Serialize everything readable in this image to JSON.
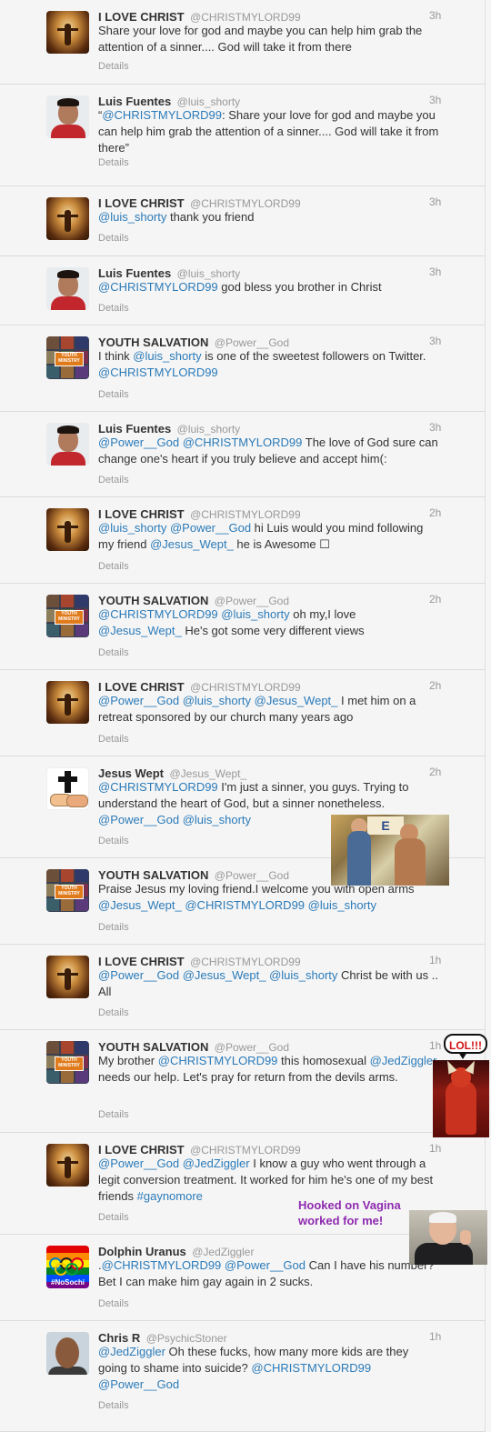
{
  "tweets": [
    {
      "avatar": "christ",
      "name": "I LOVE CHRIST",
      "handle": "@CHRISTMYLORD99",
      "time": "3h",
      "text": [
        {
          "t": "Share your love for god and maybe you can help him grab the attention of a sinner.... God will take it from there"
        }
      ],
      "details": "Details"
    },
    {
      "avatar": "luis",
      "name": "Luis Fuentes",
      "handle": "@luis_shorty",
      "time": "3h",
      "text": [
        {
          "t": "“"
        },
        {
          "m": "@CHRISTMYLORD99"
        },
        {
          "t": ": Share your love for god and maybe you can help him grab the attention of a sinner.... God will take it from there”"
        }
      ],
      "details": "Details"
    },
    {
      "avatar": "christ",
      "name": "I LOVE CHRIST",
      "handle": "@CHRISTMYLORD99",
      "time": "3h",
      "text": [
        {
          "m": "@luis_shorty"
        },
        {
          "t": " thank you friend"
        }
      ],
      "details": "Details"
    },
    {
      "avatar": "luis",
      "name": "Luis Fuentes",
      "handle": "@luis_shorty",
      "time": "3h",
      "text": [
        {
          "m": "@CHRISTMYLORD99"
        },
        {
          "t": " god bless you brother in Christ"
        }
      ],
      "details": "Details"
    },
    {
      "avatar": "youth",
      "name": "YOUTH SALVATION",
      "handle": "@Power__God",
      "time": "3h",
      "text": [
        {
          "t": "I think "
        },
        {
          "m": "@luis_shorty"
        },
        {
          "t": " is one of the sweetest followers on Twitter. "
        },
        {
          "m": "@CHRISTMYLORD99"
        }
      ],
      "details": "Details"
    },
    {
      "avatar": "luis",
      "name": "Luis Fuentes",
      "handle": "@luis_shorty",
      "time": "3h",
      "text": [
        {
          "m": "@Power__God"
        },
        {
          "t": " "
        },
        {
          "m": "@CHRISTMYLORD99"
        },
        {
          "t": " The love of God sure can change one's heart if you truly believe and accept him(:"
        }
      ],
      "details": "Details"
    },
    {
      "avatar": "christ",
      "name": "I LOVE CHRIST",
      "handle": "@CHRISTMYLORD99",
      "time": "2h",
      "text": [
        {
          "m": "@luis_shorty"
        },
        {
          "t": " "
        },
        {
          "m": "@Power__God"
        },
        {
          "t": "  hi Luis would you mind following my friend "
        },
        {
          "m": "@Jesus_Wept_"
        },
        {
          "t": "  he is Awesome ☐"
        }
      ],
      "details": "Details"
    },
    {
      "avatar": "youth",
      "name": "YOUTH SALVATION",
      "handle": "@Power__God",
      "time": "2h",
      "text": [
        {
          "m": "@CHRISTMYLORD99"
        },
        {
          "t": " "
        },
        {
          "m": "@luis_shorty"
        },
        {
          "t": " oh my,I love "
        },
        {
          "m": "@Jesus_Wept_"
        },
        {
          "t": " He's got some very different views"
        }
      ],
      "details": "Details"
    },
    {
      "avatar": "christ",
      "name": "I LOVE CHRIST",
      "handle": "@CHRISTMYLORD99",
      "time": "2h",
      "text": [
        {
          "m": "@Power__God"
        },
        {
          "t": " "
        },
        {
          "m": "@luis_shorty"
        },
        {
          "t": " "
        },
        {
          "m": "@Jesus_Wept_"
        },
        {
          "t": "  I met him on a retreat sponsored by our church many years ago"
        }
      ],
      "details": "Details"
    },
    {
      "avatar": "wept",
      "name": "Jesus Wept",
      "handle": "@Jesus_Wept_",
      "time": "2h",
      "text": [
        {
          "m": "@CHRISTMYLORD99"
        },
        {
          "t": " I'm just a sinner, you guys. Trying to understand the heart of God, but a sinner nonetheless. "
        },
        {
          "m": "@Power__God"
        },
        {
          "t": " "
        },
        {
          "m": "@luis_shorty"
        }
      ],
      "details": "Details"
    },
    {
      "avatar": "youth",
      "name": "YOUTH SALVATION",
      "handle": "@Power__God",
      "time": "2h",
      "text": [
        {
          "t": "Praise Jesus my loving friend.I welcome you with open arms "
        },
        {
          "m": "@Jesus_Wept_"
        },
        {
          "t": " "
        },
        {
          "m": "@CHRISTMYLORD99"
        },
        {
          "t": " "
        },
        {
          "m": "@luis_shorty"
        }
      ],
      "details": "Details"
    },
    {
      "avatar": "christ",
      "name": "I LOVE CHRIST",
      "handle": "@CHRISTMYLORD99",
      "time": "1h",
      "text": [
        {
          "m": "@Power__God"
        },
        {
          "t": " "
        },
        {
          "m": "@Jesus_Wept_"
        },
        {
          "t": " "
        },
        {
          "m": "@luis_shorty"
        },
        {
          "t": " Christ be with us .. All"
        }
      ],
      "details": "Details"
    },
    {
      "avatar": "youth",
      "name": "YOUTH SALVATION",
      "handle": "@Power__God",
      "time": "1h",
      "text": [
        {
          "t": "My brother "
        },
        {
          "m": "@CHRISTMYLORD99"
        },
        {
          "t": "  this homosexual "
        },
        {
          "m": "@JedZiggler"
        },
        {
          "t": " needs our help. Let's pray for return from the devils arms."
        }
      ],
      "details": "Details"
    },
    {
      "avatar": "christ",
      "name": "I LOVE CHRIST",
      "handle": "@CHRISTMYLORD99",
      "time": "1h",
      "text": [
        {
          "m": "@Power__God"
        },
        {
          "t": " "
        },
        {
          "m": "@JedZiggler"
        },
        {
          "t": " I know a guy who went through a legit conversion treatment. It worked for him he's one of my best friends "
        },
        {
          "m": "#gaynomore"
        }
      ],
      "details": "Details"
    },
    {
      "avatar": "dolphin",
      "name": "Dolphin Uranus",
      "handle": "@JedZiggler",
      "time": "1h",
      "text": [
        {
          "t": "."
        },
        {
          "m": "@CHRISTMYLORD99"
        },
        {
          "t": " "
        },
        {
          "m": "@Power__God"
        },
        {
          "t": " Can I have his number?  Bet I can make him gay again in 2 sucks."
        }
      ],
      "details": "Details"
    },
    {
      "avatar": "chris",
      "name": "Chris R",
      "handle": "@PsychicStoner",
      "time": "1h",
      "text": [
        {
          "m": "@JedZiggler"
        },
        {
          "t": " Oh these fucks, how many more kids are they going to shame into suicide? "
        },
        {
          "m": "@CHRISTMYLORD99"
        },
        {
          "t": " "
        },
        {
          "m": "@Power__God"
        }
      ],
      "details": "Details"
    }
  ],
  "overlays": {
    "lol_text": "LOL!!!",
    "hooked_text": "Hooked on Vagina worked for me!",
    "crowd_sign": "E",
    "youth_badge": "YOUTH MINISTRY",
    "nosochi_tag": "#NoSochi"
  },
  "colors": {
    "link": "#2b7bb9",
    "name": "#333333",
    "meta": "#999999",
    "purple_text": "#8e2ab0"
  }
}
